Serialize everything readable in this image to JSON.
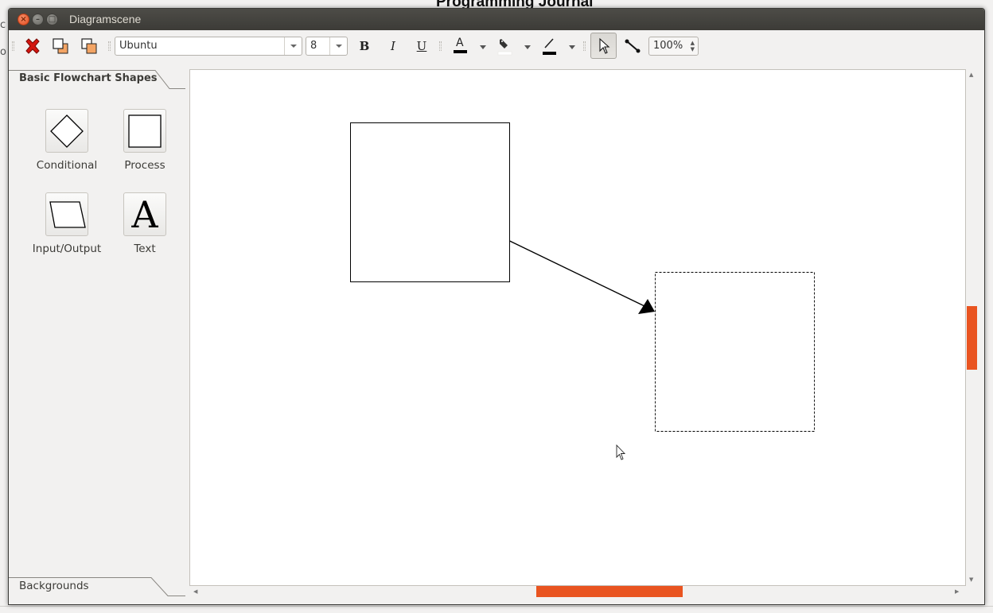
{
  "background_app": {
    "title": "Programming Journal",
    "fragment_1": "c",
    "fragment_2": "o"
  },
  "window": {
    "title": "Diagramscene",
    "close_glyph": "×",
    "minimize_glyph": "–",
    "maximize_glyph": "□"
  },
  "toolbar": {
    "font_value": "Ubuntu",
    "size_value": "8",
    "bold_label": "B",
    "italic_label": "I",
    "underline_label": "U",
    "font_color_glyph": "A",
    "zoom_value": "100%",
    "spin_up": "▲",
    "spin_down": "▼",
    "icons": [
      "delete-icon",
      "bring-to-front-icon",
      "send-to-back-icon",
      "font-color-icon",
      "fill-color-icon",
      "line-color-icon",
      "pointer-icon",
      "line-connector-icon"
    ]
  },
  "sidebar": {
    "tabs": [
      "Basic Flowchart Shapes",
      "Backgrounds"
    ],
    "items": [
      {
        "label": "Conditional",
        "icon": "diamond-icon"
      },
      {
        "label": "Process",
        "icon": "square-icon"
      },
      {
        "label": "Input/Output",
        "icon": "parallelogram-icon"
      },
      {
        "label": "Text",
        "icon": "text-icon",
        "glyph": "A"
      }
    ]
  },
  "canvas": {
    "items": [
      "process-box",
      "arrow-connector",
      "selected-box (dashed)"
    ]
  },
  "colors": {
    "accent": "#e95420",
    "titlebar": "#3c3b37",
    "window_bg": "#f2f1f0"
  }
}
